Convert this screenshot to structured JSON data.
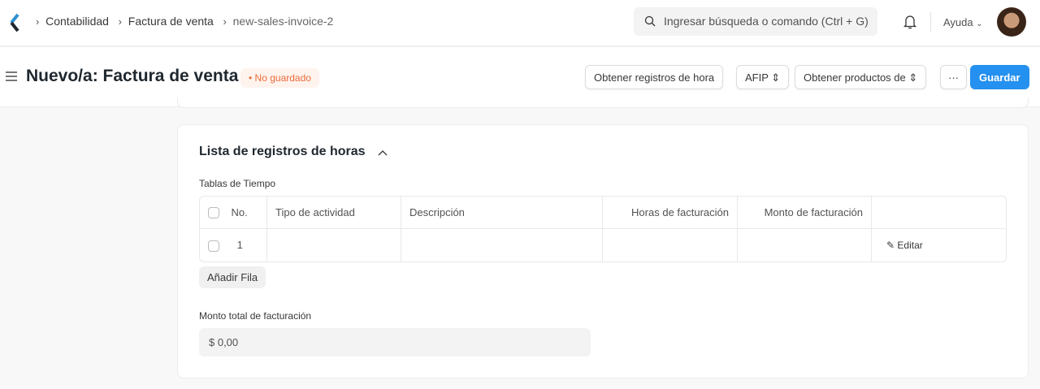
{
  "breadcrumb": [
    "Contabilidad",
    "Factura de venta",
    "new-sales-invoice-2"
  ],
  "search": {
    "placeholder": "Ingresar búsqueda o comando (Ctrl + G)"
  },
  "help_label": "Ayuda",
  "page_title": "Nuevo/a: Factura de venta",
  "status_badge": "No guardado",
  "toolbar": {
    "get_timesheets": "Obtener registros de hora",
    "afip": "AFIP",
    "get_items": "Obtener productos de",
    "more": "···",
    "save": "Guardar"
  },
  "section": {
    "title": "Lista de registros de horas",
    "table_label": "Tablas de Tiempo",
    "columns": [
      "No.",
      "Tipo de actividad",
      "Descripción",
      "Horas de facturación",
      "Monto de facturación"
    ],
    "rows": [
      {
        "no": "1",
        "edit": "Editar"
      }
    ],
    "add_row": "Añadir Fila",
    "total_label": "Monto total de facturación",
    "total_value": "$ 0,00"
  },
  "colors": {
    "primary": "#2490ef",
    "badge": "#e86c3a"
  }
}
